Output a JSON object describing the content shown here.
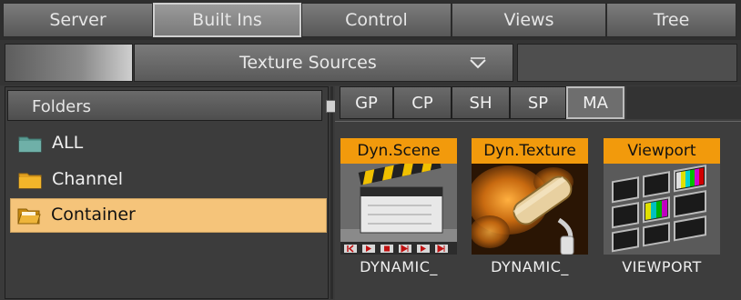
{
  "top_tabs": [
    {
      "label": "Server",
      "active": false
    },
    {
      "label": "Built Ins",
      "active": true
    },
    {
      "label": "Control",
      "active": false
    },
    {
      "label": "Views",
      "active": false
    },
    {
      "label": "Tree",
      "active": false
    }
  ],
  "source_dropdown": {
    "value": "Texture Sources"
  },
  "folders": {
    "header": "Folders",
    "items": [
      {
        "label": "ALL",
        "icon": "teal-folder-icon",
        "selected": false
      },
      {
        "label": "Channel",
        "icon": "folder-icon",
        "selected": false
      },
      {
        "label": "Container",
        "icon": "open-folder-icon",
        "selected": true
      }
    ]
  },
  "sub_tabs": [
    {
      "label": "GP",
      "active": false
    },
    {
      "label": "CP",
      "active": false
    },
    {
      "label": "SH",
      "active": false
    },
    {
      "label": "SP",
      "active": false
    },
    {
      "label": "MA",
      "active": true
    }
  ],
  "tiles": [
    {
      "title": "Dyn.Scene",
      "name": "DYNAMIC_",
      "icon": "clapperboard-icon"
    },
    {
      "title": "Dyn.Texture",
      "name": "DYNAMIC_",
      "icon": "paint-roller-icon"
    },
    {
      "title": "Viewport",
      "name": "VIEWPORT",
      "icon": "viewport-screens-icon"
    }
  ],
  "colors": {
    "accent_orange": "#f29a0c",
    "selected_folder": "#f5c47a",
    "background": "#3a3a3a"
  }
}
